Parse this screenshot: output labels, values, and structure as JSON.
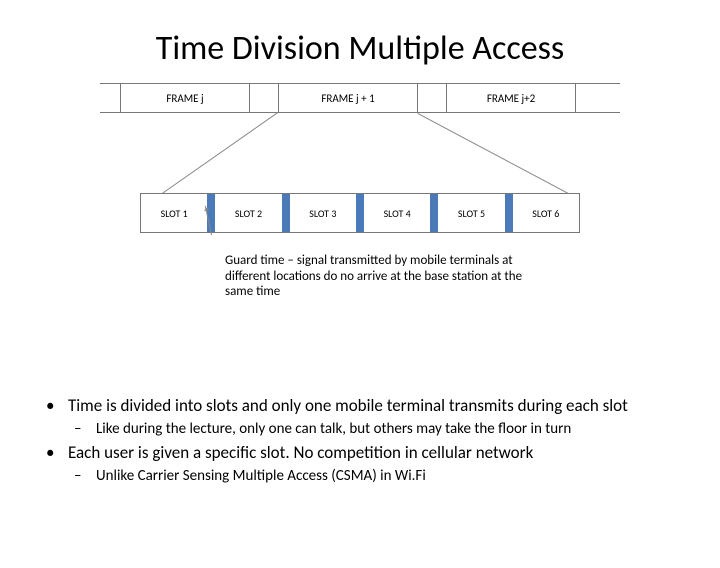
{
  "title": "Time Division Multiple Access",
  "frames": [
    "FRAME   j",
    "FRAME   j + 1",
    "FRAME   j+2"
  ],
  "slots": [
    "SLOT 1",
    "SLOT 2",
    "SLOT 3",
    "SLOT 4",
    "SLOT 5",
    "SLOT 6"
  ],
  "guard_text": "Guard time – signal transmitted by mobile terminals at different locations do no arrive at the base station at the same time",
  "bullets": [
    {
      "text": "Time is divided into slots and only one mobile terminal transmits during each slot",
      "sub": [
        "Like during the lecture, only one can talk, but others may take the floor in turn"
      ]
    },
    {
      "text": "Each user is given a specific slot. No competition in cellular network",
      "sub": [
        "Unlike Carrier Sensing Multiple Access (CSMA) in Wi.Fi"
      ]
    }
  ]
}
